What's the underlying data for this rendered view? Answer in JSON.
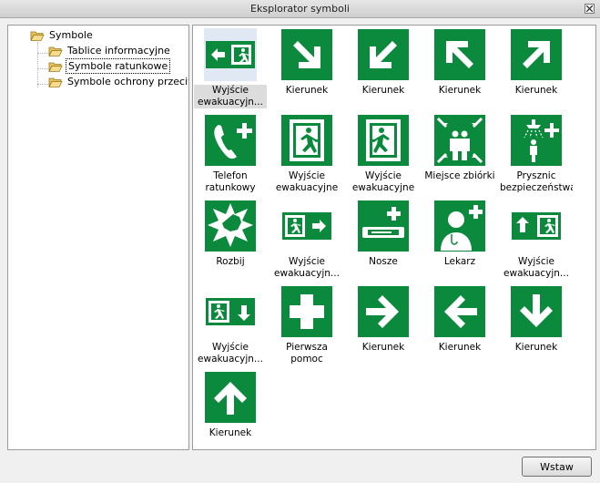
{
  "window": {
    "title": "Eksplorator symboli"
  },
  "colors": {
    "sign_green": "#0b8a3e",
    "selection": "#e0e8f4"
  },
  "tree": {
    "root": "Symbole",
    "children": [
      {
        "label": "Tablice informacyjne",
        "selected": false
      },
      {
        "label": "Symbole ratunkowe",
        "selected": true
      },
      {
        "label": "Symbole ochrony przeciwp..."
      }
    ]
  },
  "symbols": [
    {
      "cap1": "Wyjście",
      "cap2": "ewakuacyjn...",
      "icon": "exit-arrow-left-icon",
      "selected": true
    },
    {
      "cap1": "Kierunek",
      "cap2": "",
      "icon": "arrow-down-right-icon"
    },
    {
      "cap1": "Kierunek",
      "cap2": "",
      "icon": "arrow-down-left-icon"
    },
    {
      "cap1": "Kierunek",
      "cap2": "",
      "icon": "arrow-up-left-icon"
    },
    {
      "cap1": "Kierunek",
      "cap2": "",
      "icon": "arrow-up-right-icon"
    },
    {
      "cap1": "Telefon",
      "cap2": "ratunkowy",
      "icon": "emergency-phone-icon"
    },
    {
      "cap1": "Wyjście",
      "cap2": "ewakuacyjne",
      "icon": "exit-door-left-icon"
    },
    {
      "cap1": "Wyjście",
      "cap2": "ewakuacyjne",
      "icon": "exit-door-right-icon"
    },
    {
      "cap1": "Miejsce zbiórki",
      "cap2": "",
      "icon": "assembly-point-icon"
    },
    {
      "cap1": "Prysznic",
      "cap2": "bezpieczeństwa",
      "icon": "safety-shower-icon"
    },
    {
      "cap1": "Rozbij",
      "cap2": "",
      "icon": "break-glass-icon"
    },
    {
      "cap1": "Wyjście",
      "cap2": "ewakuacyjn...",
      "icon": "exit-arrow-right-icon"
    },
    {
      "cap1": "Nosze",
      "cap2": "",
      "icon": "stretcher-icon"
    },
    {
      "cap1": "Lekarz",
      "cap2": "",
      "icon": "doctor-icon"
    },
    {
      "cap1": "Wyjście",
      "cap2": "ewakuacyjn...",
      "icon": "exit-arrow-up-icon"
    },
    {
      "cap1": "Wyjście",
      "cap2": "ewakuacyjn...",
      "icon": "exit-arrow-down-icon"
    },
    {
      "cap1": "Pierwsza pomoc",
      "cap2": "",
      "icon": "first-aid-cross-icon"
    },
    {
      "cap1": "Kierunek",
      "cap2": "",
      "icon": "arrow-right-icon"
    },
    {
      "cap1": "Kierunek",
      "cap2": "",
      "icon": "arrow-left-icon"
    },
    {
      "cap1": "Kierunek",
      "cap2": "",
      "icon": "arrow-down-icon"
    },
    {
      "cap1": "Kierunek",
      "cap2": "",
      "icon": "arrow-up-icon"
    }
  ],
  "buttons": {
    "insert": "Wstaw"
  }
}
